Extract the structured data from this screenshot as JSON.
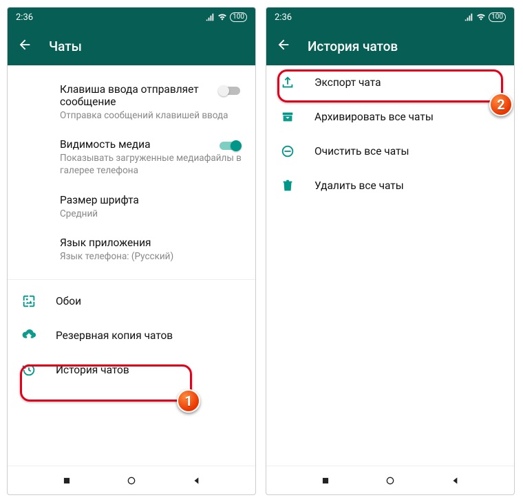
{
  "colors": {
    "primary": "#075E54",
    "accent": "#009688",
    "highlight": "#e2001a"
  },
  "status": {
    "time": "2:36",
    "battery": "100"
  },
  "left": {
    "title": "Чаты",
    "settings": {
      "enter": {
        "label": "Клавиша ввода отправляет сообщение",
        "sub": "Отправка сообщений клавишей ввода",
        "on": false
      },
      "media": {
        "label": "Видимость медиа",
        "sub": "Показывать загруженные медиафайлы в галерее телефона",
        "on": true
      },
      "font": {
        "label": "Размер шрифта",
        "sub": "Средний"
      },
      "lang": {
        "label": "Язык приложения",
        "sub": "Язык телефона: (Русский)"
      }
    },
    "rows": {
      "wallpaper": "Обои",
      "backup": "Резервная копия чатов",
      "history": "История чатов"
    },
    "badge": "1"
  },
  "right": {
    "title": "История чатов",
    "rows": {
      "export": "Экспорт чата",
      "archive": "Архивировать все чаты",
      "clear": "Очистить все чаты",
      "delete": "Удалить все чаты"
    },
    "badge": "2"
  }
}
